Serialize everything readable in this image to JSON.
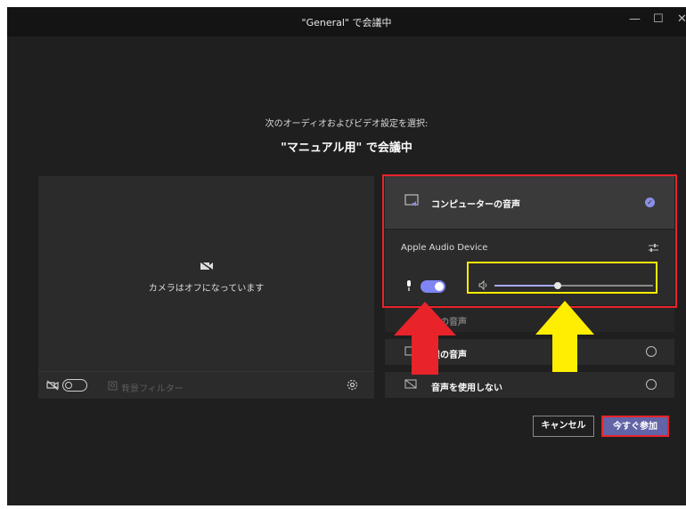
{
  "window": {
    "title": "\"General\" で会議中",
    "controls": {
      "minimize": "—",
      "maximize": "☐",
      "close": "✕"
    }
  },
  "header": {
    "subtitle": "次のオーディオおよびビデオ設定を選択:",
    "meeting_title": "\"マニュアル用\" で会議中"
  },
  "camera": {
    "off_text": "カメラはオフになっています",
    "background_filter": "背景フィルター",
    "camera_toggle": false
  },
  "audio": {
    "computer_audio_label": "コンピューターの音声",
    "device_name": "Apple Audio Device",
    "mic_toggle": true,
    "volume_level": 0.4,
    "phone_audio_partial": "話の音声",
    "room_audio_partial": "屋の音声",
    "no_audio_label": "音声を使用しない"
  },
  "buttons": {
    "cancel": "キャンセル",
    "join_now": "今すぐ参加"
  },
  "colors": {
    "accent": "#6264a7",
    "toggle_on": "#7f85f5",
    "red_highlight": "#e8232a",
    "yellow_highlight": "#ffee00"
  }
}
